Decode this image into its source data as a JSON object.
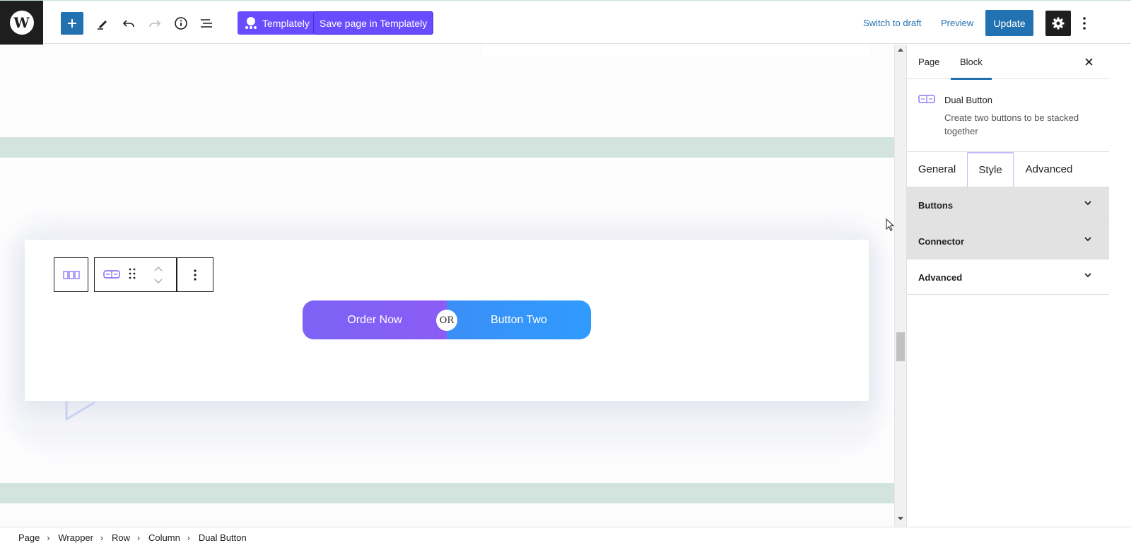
{
  "topbar": {
    "logo_letter": "W",
    "templately_label": "Templately",
    "save_templately_label": "Save page in Templately",
    "switch_draft_label": "Switch to draft",
    "preview_label": "Preview",
    "update_label": "Update"
  },
  "canvas": {
    "dual_button": {
      "button_one": "Order Now",
      "connector": "OR",
      "button_two": "Button Two"
    }
  },
  "sidebar": {
    "tabs": {
      "page": "Page",
      "block": "Block"
    },
    "block_info": {
      "title": "Dual Button",
      "description": "Create two buttons to be stacked together"
    },
    "inner_tabs": {
      "general": "General",
      "style": "Style",
      "advanced": "Advanced"
    },
    "panels": {
      "buttons": "Buttons",
      "connector": "Connector",
      "advanced": "Advanced"
    }
  },
  "breadcrumb": [
    "Page",
    "Wrapper",
    "Row",
    "Column",
    "Dual Button"
  ],
  "colors": {
    "accent": "#2271b1",
    "templately": "#6a4cff",
    "button_one": "#7b63f5",
    "button_two": "#2f9bff",
    "band": "#d3e4de"
  }
}
